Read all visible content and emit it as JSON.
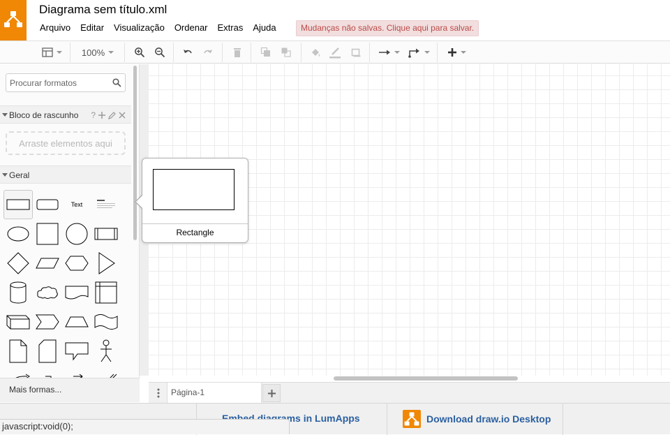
{
  "app": {
    "title": "Diagrama sem título.xml",
    "brand_color": "#f08705"
  },
  "menu": [
    "Arquivo",
    "Editar",
    "Visualização",
    "Ordenar",
    "Extras",
    "Ajuda"
  ],
  "unsaved_banner": "Mudanças não salvas. Clique aqui para salvar.",
  "toolbar": {
    "zoom": "100%",
    "icons": [
      "format-panel-icon",
      "zoom-in-icon",
      "zoom-out-icon",
      "undo-icon",
      "redo-icon",
      "delete-icon",
      "to-front-icon",
      "to-back-icon",
      "fill-color-icon",
      "line-color-icon",
      "shadow-icon",
      "connection-icon",
      "waypoints-icon",
      "insert-icon"
    ]
  },
  "sidebar": {
    "search_placeholder": "Procurar formatos",
    "scratchpad_title": "Bloco de rascunho",
    "scratchpad_help": "?",
    "scratchpad_drop": "Arraste elementos aqui",
    "general_title": "Geral",
    "text_shape_label": "Text",
    "heading_shape_label": "Heading",
    "more_shapes": "Mais formas..."
  },
  "tooltip": {
    "shape_name": "Rectangle"
  },
  "pages": {
    "current": "Página-1",
    "add": "+"
  },
  "footer": {
    "embed_link": "Embed diagrams in LumApps",
    "download_link": "Download draw.io Desktop"
  },
  "status_bar": "javascript:void(0);"
}
